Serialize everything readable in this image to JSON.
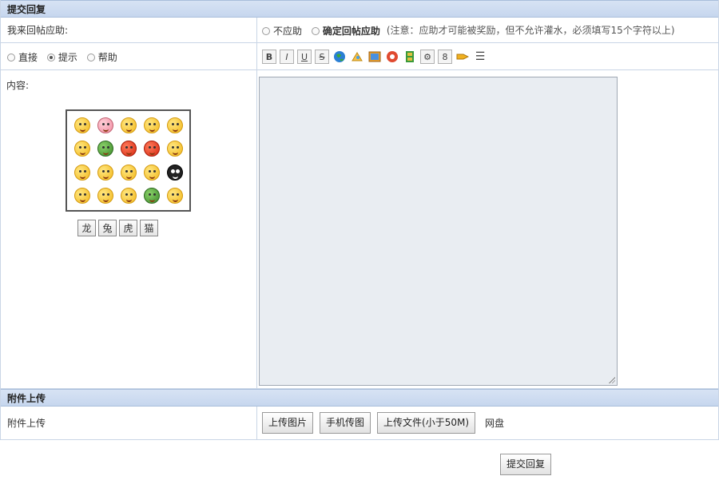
{
  "reply_section": {
    "title": "提交回复"
  },
  "bounty_row": {
    "label": "我来回帖应助:",
    "opt_no": "不应助",
    "opt_yes": "确定回帖应助",
    "note": "(注意：应助才可能被奖励，但不允许灌水，必须填写15个字符以上)"
  },
  "mode_row": {
    "opt_direct": "直接",
    "opt_hint": "提示",
    "opt_help": "帮助"
  },
  "toolbar": {
    "bold": "B",
    "italic": "I",
    "underline": "U",
    "strike": "S",
    "list": "☰"
  },
  "content": {
    "label": "内容:"
  },
  "emoji_categories": [
    "龙",
    "兔",
    "虎",
    "猫"
  ],
  "attach_section": {
    "title": "附件上传"
  },
  "attach_row": {
    "label": "附件上传",
    "upload_image": "上传图片",
    "mobile_image": "手机传图",
    "upload_file": "上传文件(小于50M)",
    "netdisk": "网盘"
  },
  "submit": {
    "label": "提交回复"
  },
  "colors": {
    "header_bg": "#d7e3f4",
    "border": "#c9d5e6",
    "textarea_bg": "#e9edf2"
  }
}
